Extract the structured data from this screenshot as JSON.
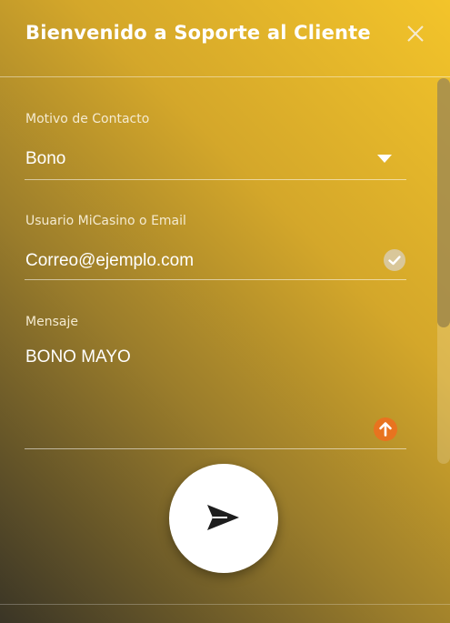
{
  "header": {
    "title": "Bienvenido a Soporte al Cliente",
    "close_icon": "close-icon"
  },
  "form": {
    "contact_reason": {
      "label": "Motivo de Contacto",
      "value": "Bono",
      "icon": "chevron-down-icon"
    },
    "user": {
      "label": "Usuario MiCasino o Email",
      "value": "Correo@ejemplo.com",
      "icon": "check-circle-icon"
    },
    "message": {
      "label": "Mensaje",
      "value": "BONO MAYO",
      "icon": "upload-arrow-icon"
    },
    "send_icon": "send-icon"
  },
  "colors": {
    "accent_upload": "#e8731f",
    "check_circle": "#d9c79a",
    "gradient_top": "#f3c42a",
    "gradient_bottom": "#3a3526"
  }
}
